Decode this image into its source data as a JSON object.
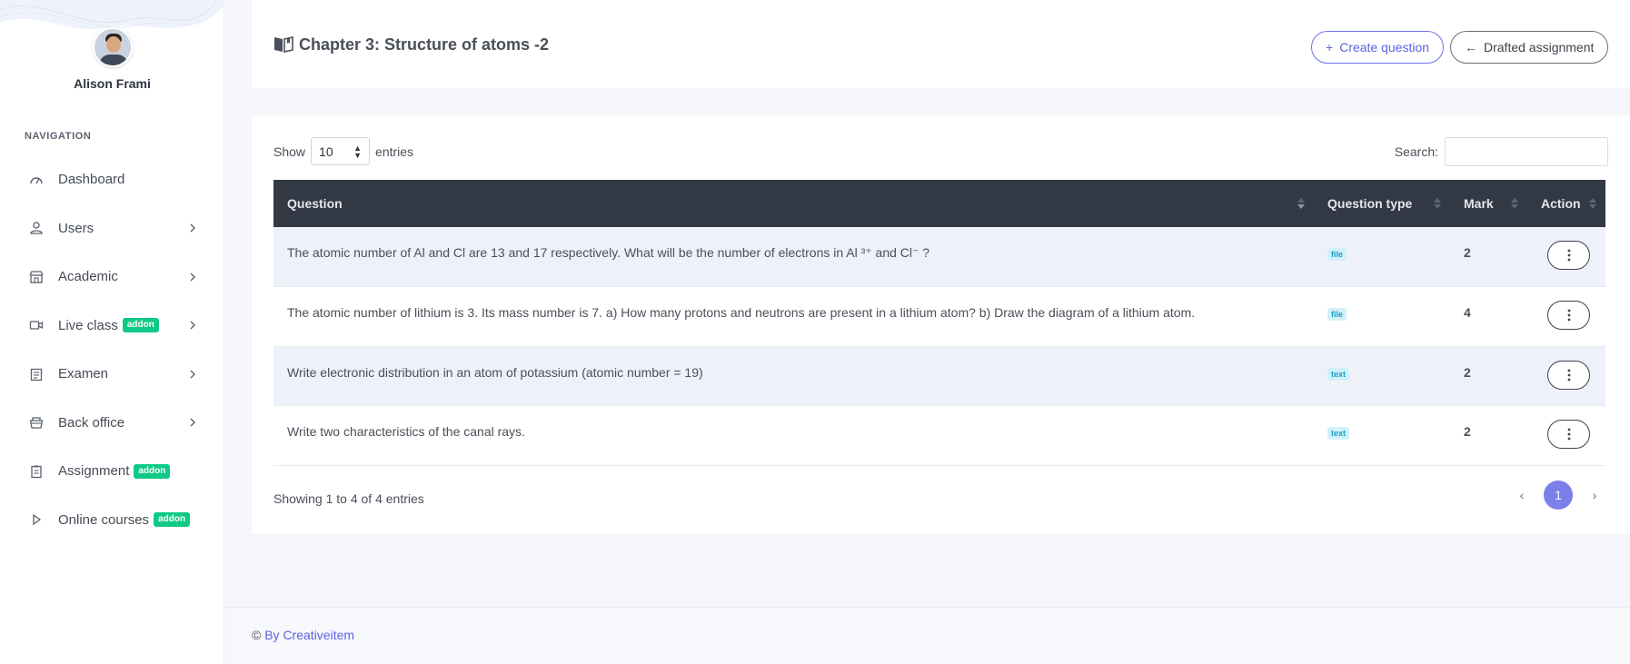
{
  "profile": {
    "name": "Alison Frami"
  },
  "nav": {
    "heading": "NAVIGATION",
    "items": [
      {
        "label": "Dashboard",
        "icon": "dashboard-gauge-icon",
        "addon": false,
        "chevron": false
      },
      {
        "label": "Users",
        "icon": "user-icon",
        "addon": false,
        "chevron": true
      },
      {
        "label": "Academic",
        "icon": "school-icon",
        "addon": false,
        "chevron": true
      },
      {
        "label": "Live class",
        "icon": "video-camera-icon",
        "addon": true,
        "chevron": true
      },
      {
        "label": "Examen",
        "icon": "clipboard-icon",
        "addon": false,
        "chevron": true
      },
      {
        "label": "Back office",
        "icon": "basket-icon",
        "addon": false,
        "chevron": true
      },
      {
        "label": "Assignment",
        "icon": "checklist-icon",
        "addon": true,
        "chevron": false
      },
      {
        "label": "Online courses",
        "icon": "play-icon",
        "addon": true,
        "chevron": false
      }
    ],
    "addon_label": "addon"
  },
  "header": {
    "title": "Chapter 3: Structure of atoms -2",
    "create_button": "Create question",
    "drafted_button": "Drafted assignment"
  },
  "table_controls": {
    "show_label": "Show",
    "entries_value": "10",
    "entries_label": "entries",
    "search_label": "Search:",
    "search_value": ""
  },
  "table": {
    "columns": [
      "Question",
      "Question type",
      "Mark",
      "Action"
    ],
    "rows": [
      {
        "question": "The atomic number of Al and Cl are 13 and 17 respectively. What will be the number of electrons in Al ³⁺ and Cl⁻ ?",
        "type": "file",
        "mark": "2"
      },
      {
        "question": "The atomic number of lithium is 3. Its mass number is 7. a) How many protons and neutrons are present in a lithium atom? b) Draw the diagram of a lithium atom.",
        "type": "file",
        "mark": "4"
      },
      {
        "question": "Write electronic distribution in an atom of potassium (atomic number = 19)",
        "type": "text",
        "mark": "2"
      },
      {
        "question": "Write two characteristics of the canal rays.",
        "type": "text",
        "mark": "2"
      }
    ]
  },
  "pagination": {
    "summary": "Showing 1 to 4 of 4 entries",
    "current_page": "1",
    "prev": "‹",
    "next": "›"
  },
  "footer": {
    "prefix": "©",
    "link": "By Creativeitem"
  },
  "colors": {
    "accent": "#6d72e8",
    "addon_green": "#10c986",
    "table_header": "#323844",
    "annotation_arrow": "#ff2a14"
  }
}
